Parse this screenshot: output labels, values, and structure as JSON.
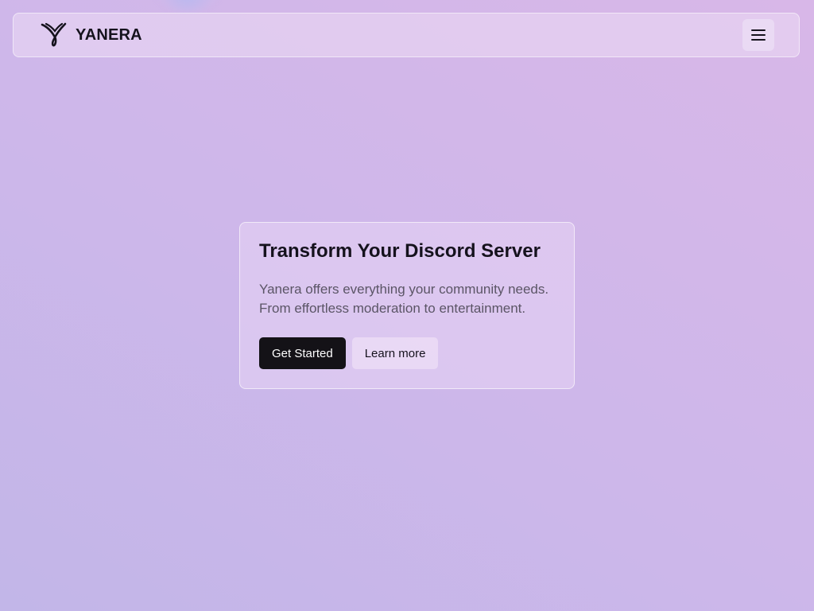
{
  "nav": {
    "brand_name": "YANERA",
    "logo_icon": "yanera-logo-icon",
    "menu_icon": "hamburger-menu-icon"
  },
  "hero": {
    "title": "Transform Your Discord Server",
    "description": "Yanera offers everything your community needs. From effortless moderation to entertainment.",
    "primary_button": "Get Started",
    "secondary_button": "Learn more"
  },
  "colors": {
    "background_start": "#c2b6e8",
    "background_end": "#d8b7e8",
    "primary_button_bg": "#141217",
    "text": "#15121d",
    "muted_text": "#5b5566"
  }
}
